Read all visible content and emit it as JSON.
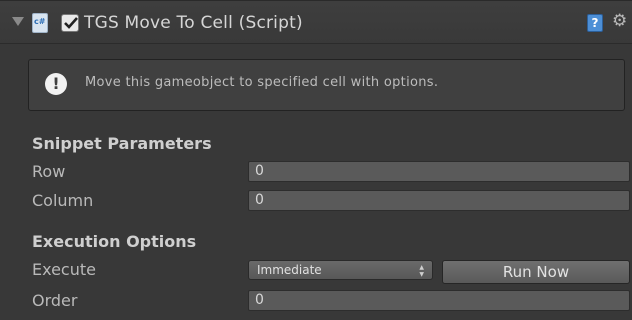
{
  "component": {
    "title": "TGS Move To Cell (Script)",
    "enabled": true
  },
  "helpbox": {
    "message": "Move this gameobject to specified cell with options."
  },
  "sections": {
    "snippet": "Snippet Parameters",
    "execution": "Execution Options"
  },
  "fields": {
    "row": {
      "label": "Row",
      "value": "0"
    },
    "column": {
      "label": "Column",
      "value": "0"
    },
    "execute": {
      "label": "Execute",
      "value": "Immediate"
    },
    "order": {
      "label": "Order",
      "value": "0"
    }
  },
  "buttons": {
    "run_now": "Run Now"
  },
  "icons": {
    "foldout": "foldout-triangle-icon",
    "script": "cs-script-icon",
    "help": "help-book-icon",
    "settings": "gear-icon",
    "info": "info-exclamation-icon"
  },
  "colors": {
    "panel_bg": "#383838",
    "field_bg": "#5a5a5a",
    "text": "#b9b9b9",
    "help_icon": "#4d8fd6"
  }
}
